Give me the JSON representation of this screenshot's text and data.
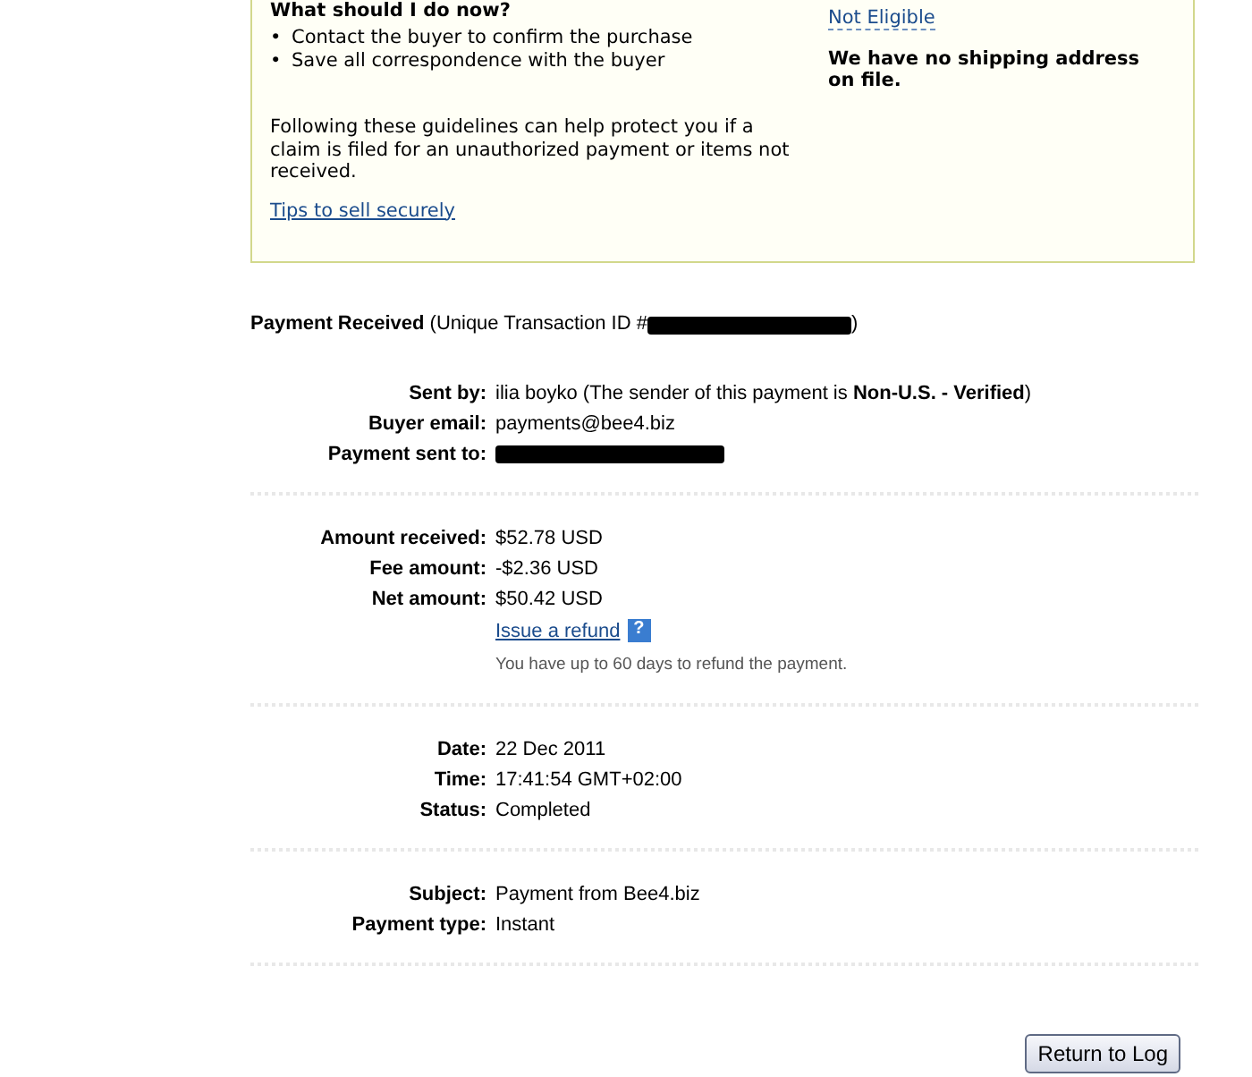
{
  "guidance": {
    "heading": "What should I do now?",
    "steps": [
      {
        "bullet": "•",
        "text": "Contact the buyer to confirm the purchase"
      },
      {
        "bullet": "•",
        "text": "Save all correspondence with the buyer"
      }
    ],
    "note": "Following these guidelines can help protect you if a claim is filed for an unauthorized payment or items not received.",
    "link": "Tips to sell securely",
    "eligibility_link": "Not Eligible",
    "shipping_note": "We have no shipping address on file."
  },
  "payment": {
    "title": "**Payment Received** (Unique Transaction ID #",
    "title_end": ")",
    "groups": [
      [
        {
          "label": "Sent by:",
          "kind": "text",
          "value": "ilia boyko (The sender of this payment is **Non-U.S. - Verified**)"
        },
        {
          "label": "Buyer email:",
          "kind": "text",
          "value": "payments@bee4.biz"
        },
        {
          "label": "Payment sent to:",
          "kind": "redacted"
        }
      ],
      [
        {
          "label": "Amount received:",
          "kind": "text",
          "value": "$52.78 USD"
        },
        {
          "label": "Fee amount:",
          "kind": "text",
          "value": "-$2.36 USD"
        },
        {
          "label": "Net amount:",
          "kind": "text",
          "value": "$50.42 USD"
        },
        {
          "kind": "link",
          "value": "Issue a refund",
          "help": "?"
        },
        {
          "kind": "note",
          "value": "You have up to 60 days to refund the payment."
        }
      ],
      [
        {
          "label": "Date:",
          "kind": "text",
          "value": "22 Dec 2011"
        },
        {
          "label": "Time:",
          "kind": "text",
          "value": "17:41:54 GMT+02:00"
        },
        {
          "label": "Status:",
          "kind": "text",
          "value": "Completed"
        }
      ],
      [
        {
          "label": "Subject:",
          "kind": "text",
          "value": "Payment from Bee4.biz"
        },
        {
          "label": "Payment type:",
          "kind": "text",
          "value": "Instant"
        }
      ]
    ]
  },
  "return_button": "Return to Log"
}
